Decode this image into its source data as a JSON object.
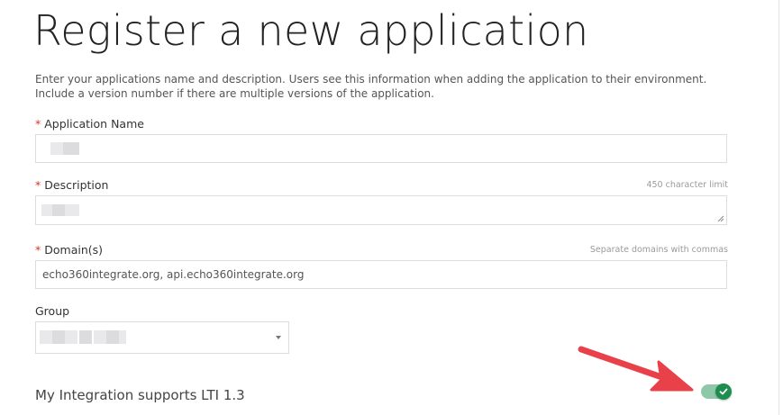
{
  "page": {
    "title": "Register a new application",
    "intro": "Enter your applications name and description. Users see this information when adding the application to their environment. Include a version number if there are multiple versions of the application."
  },
  "fields": {
    "app_name": {
      "required_mark": "*",
      "label": "Application Name",
      "value": ""
    },
    "description": {
      "required_mark": "*",
      "label": "Description",
      "hint": "450 character limit",
      "value": ""
    },
    "domains": {
      "required_mark": "*",
      "label": "Domain(s)",
      "hint": "Separate domains with commas",
      "value": "echo360integrate.org, api.echo360integrate.org"
    },
    "group": {
      "label": "Group",
      "value": ""
    }
  },
  "lti": {
    "label": "My Integration supports LTI 1.3",
    "enabled": true
  },
  "colors": {
    "required": "#d9322a",
    "toggle_on": "#1e8e4e",
    "annotation_arrow": "#e8414a"
  },
  "icons": {
    "toggle_check": "check-icon",
    "group_caret": "caret-down-icon",
    "annotation": "arrow-icon"
  }
}
